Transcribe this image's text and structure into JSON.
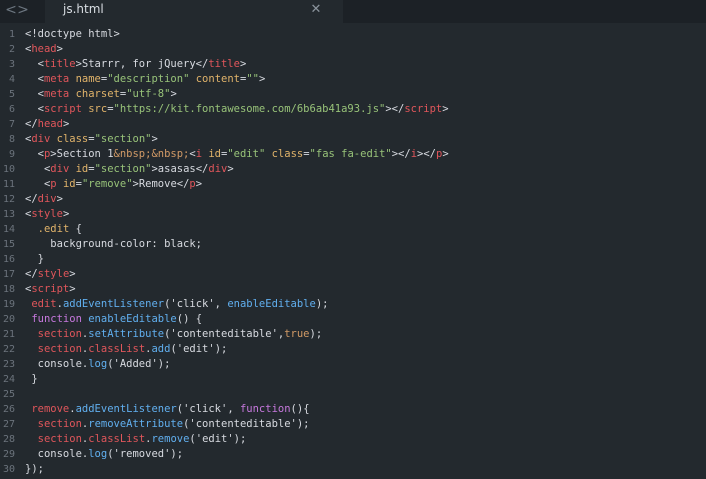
{
  "tabbar": {
    "nav_back": "<",
    "nav_forward": ">",
    "active_tab": {
      "title": "js.html",
      "close": "✕"
    }
  },
  "editor": {
    "lines": [
      {
        "n": "1",
        "tokens": [
          [
            "plain",
            "<!doctype html>"
          ]
        ]
      },
      {
        "n": "2",
        "tokens": [
          [
            "plain",
            "<"
          ],
          [
            "tag",
            "head"
          ],
          [
            "plain",
            ">"
          ]
        ]
      },
      {
        "n": "3",
        "tokens": [
          [
            "plain",
            "  <"
          ],
          [
            "tag",
            "title"
          ],
          [
            "plain",
            ">Starrr, for jQuery</"
          ],
          [
            "tag",
            "title"
          ],
          [
            "plain",
            ">"
          ]
        ]
      },
      {
        "n": "4",
        "tokens": [
          [
            "plain",
            "  <"
          ],
          [
            "tag",
            "meta"
          ],
          [
            "plain",
            " "
          ],
          [
            "attr",
            "name"
          ],
          [
            "plain",
            "="
          ],
          [
            "str",
            "\"description\""
          ],
          [
            "plain",
            " "
          ],
          [
            "attr",
            "content"
          ],
          [
            "plain",
            "="
          ],
          [
            "str",
            "\"\""
          ],
          [
            "plain",
            ">"
          ]
        ]
      },
      {
        "n": "5",
        "tokens": [
          [
            "plain",
            "  <"
          ],
          [
            "tag",
            "meta"
          ],
          [
            "plain",
            " "
          ],
          [
            "attr",
            "charset"
          ],
          [
            "plain",
            "="
          ],
          [
            "str",
            "\"utf-8\""
          ],
          [
            "plain",
            ">"
          ]
        ]
      },
      {
        "n": "6",
        "tokens": [
          [
            "plain",
            "  <"
          ],
          [
            "tag",
            "script"
          ],
          [
            "plain",
            " "
          ],
          [
            "attr",
            "src"
          ],
          [
            "plain",
            "="
          ],
          [
            "str",
            "\"https://kit.fontawesome.com/6b6ab41a93.js\""
          ],
          [
            "plain",
            "></"
          ],
          [
            "tag",
            "script"
          ],
          [
            "plain",
            ">"
          ]
        ]
      },
      {
        "n": "7",
        "tokens": [
          [
            "plain",
            "</"
          ],
          [
            "tag",
            "head"
          ],
          [
            "plain",
            ">"
          ]
        ]
      },
      {
        "n": "8",
        "tokens": [
          [
            "plain",
            "<"
          ],
          [
            "tag",
            "div"
          ],
          [
            "plain",
            " "
          ],
          [
            "attr",
            "class"
          ],
          [
            "plain",
            "="
          ],
          [
            "str",
            "\"section\""
          ],
          [
            "plain",
            ">"
          ]
        ]
      },
      {
        "n": "9",
        "tokens": [
          [
            "plain",
            "  <"
          ],
          [
            "tag",
            "p"
          ],
          [
            "plain",
            ">Section 1"
          ],
          [
            "ent",
            "&nbsp;&nbsp;"
          ],
          [
            "plain",
            "<"
          ],
          [
            "tag",
            "i"
          ],
          [
            "plain",
            " "
          ],
          [
            "attr",
            "id"
          ],
          [
            "plain",
            "="
          ],
          [
            "str",
            "\"edit\""
          ],
          [
            "plain",
            " "
          ],
          [
            "attr",
            "class"
          ],
          [
            "plain",
            "="
          ],
          [
            "str",
            "\"fas fa-edit\""
          ],
          [
            "plain",
            "></"
          ],
          [
            "tag",
            "i"
          ],
          [
            "plain",
            "></"
          ],
          [
            "tag",
            "p"
          ],
          [
            "plain",
            ">"
          ]
        ]
      },
      {
        "n": "10",
        "tokens": [
          [
            "plain",
            "   <"
          ],
          [
            "tag",
            "div"
          ],
          [
            "plain",
            " "
          ],
          [
            "attr",
            "id"
          ],
          [
            "plain",
            "="
          ],
          [
            "str",
            "\"section\""
          ],
          [
            "plain",
            ">asasas</"
          ],
          [
            "tag",
            "div"
          ],
          [
            "plain",
            ">"
          ]
        ]
      },
      {
        "n": "11",
        "tokens": [
          [
            "plain",
            "   <"
          ],
          [
            "tag",
            "p"
          ],
          [
            "plain",
            " "
          ],
          [
            "attr",
            "id"
          ],
          [
            "plain",
            "="
          ],
          [
            "str",
            "\"remove\""
          ],
          [
            "plain",
            ">Remove</"
          ],
          [
            "tag",
            "p"
          ],
          [
            "plain",
            ">"
          ]
        ]
      },
      {
        "n": "12",
        "tokens": [
          [
            "plain",
            "</"
          ],
          [
            "tag",
            "div"
          ],
          [
            "plain",
            ">"
          ]
        ]
      },
      {
        "n": "13",
        "tokens": [
          [
            "plain",
            "<"
          ],
          [
            "tag",
            "style"
          ],
          [
            "plain",
            ">"
          ]
        ]
      },
      {
        "n": "14",
        "tokens": [
          [
            "plain",
            "  "
          ],
          [
            "attr",
            ".edit"
          ],
          [
            "plain",
            " {"
          ]
        ]
      },
      {
        "n": "15",
        "tokens": [
          [
            "plain",
            "    background-color: black;"
          ]
        ]
      },
      {
        "n": "16",
        "tokens": [
          [
            "plain",
            "  }"
          ]
        ]
      },
      {
        "n": "17",
        "tokens": [
          [
            "plain",
            "</"
          ],
          [
            "tag",
            "style"
          ],
          [
            "plain",
            ">"
          ]
        ]
      },
      {
        "n": "18",
        "tokens": [
          [
            "plain",
            "<"
          ],
          [
            "tag",
            "script"
          ],
          [
            "plain",
            ">"
          ]
        ]
      },
      {
        "n": "19",
        "tokens": [
          [
            "plain",
            " "
          ],
          [
            "var",
            "edit"
          ],
          [
            "plain",
            "."
          ],
          [
            "fn",
            "addEventListener"
          ],
          [
            "plain",
            "('click', "
          ],
          [
            "fn",
            "enableEditable"
          ],
          [
            "plain",
            ");"
          ]
        ]
      },
      {
        "n": "20",
        "tokens": [
          [
            "plain",
            " "
          ],
          [
            "kw",
            "function"
          ],
          [
            "plain",
            " "
          ],
          [
            "fn",
            "enableEditable"
          ],
          [
            "plain",
            "() {"
          ]
        ]
      },
      {
        "n": "21",
        "tokens": [
          [
            "plain",
            "  "
          ],
          [
            "var",
            "section"
          ],
          [
            "plain",
            "."
          ],
          [
            "fn",
            "setAttribute"
          ],
          [
            "plain",
            "('contenteditable',"
          ],
          [
            "ent",
            "true"
          ],
          [
            "plain",
            ");"
          ]
        ]
      },
      {
        "n": "22",
        "tokens": [
          [
            "plain",
            "  "
          ],
          [
            "var",
            "section"
          ],
          [
            "plain",
            "."
          ],
          [
            "var",
            "classList"
          ],
          [
            "plain",
            "."
          ],
          [
            "fn",
            "add"
          ],
          [
            "plain",
            "('edit');"
          ]
        ]
      },
      {
        "n": "23",
        "tokens": [
          [
            "plain",
            "  console."
          ],
          [
            "fn",
            "log"
          ],
          [
            "plain",
            "('Added');"
          ]
        ]
      },
      {
        "n": "24",
        "tokens": [
          [
            "plain",
            " }"
          ]
        ]
      },
      {
        "n": "25",
        "tokens": []
      },
      {
        "n": "26",
        "tokens": [
          [
            "plain",
            " "
          ],
          [
            "var",
            "remove"
          ],
          [
            "plain",
            "."
          ],
          [
            "fn",
            "addEventListener"
          ],
          [
            "plain",
            "('click', "
          ],
          [
            "kw",
            "function"
          ],
          [
            "plain",
            "(){"
          ]
        ]
      },
      {
        "n": "27",
        "tokens": [
          [
            "plain",
            "  "
          ],
          [
            "var",
            "section"
          ],
          [
            "plain",
            "."
          ],
          [
            "fn",
            "removeAttribute"
          ],
          [
            "plain",
            "('contenteditable');"
          ]
        ]
      },
      {
        "n": "28",
        "tokens": [
          [
            "plain",
            "  "
          ],
          [
            "var",
            "section"
          ],
          [
            "plain",
            "."
          ],
          [
            "var",
            "classList"
          ],
          [
            "plain",
            "."
          ],
          [
            "fn",
            "remove"
          ],
          [
            "plain",
            "('edit');"
          ]
        ]
      },
      {
        "n": "29",
        "tokens": [
          [
            "plain",
            "  console."
          ],
          [
            "fn",
            "log"
          ],
          [
            "plain",
            "('removed');"
          ]
        ]
      },
      {
        "n": "30",
        "tokens": [
          [
            "plain",
            "});"
          ]
        ]
      }
    ]
  }
}
